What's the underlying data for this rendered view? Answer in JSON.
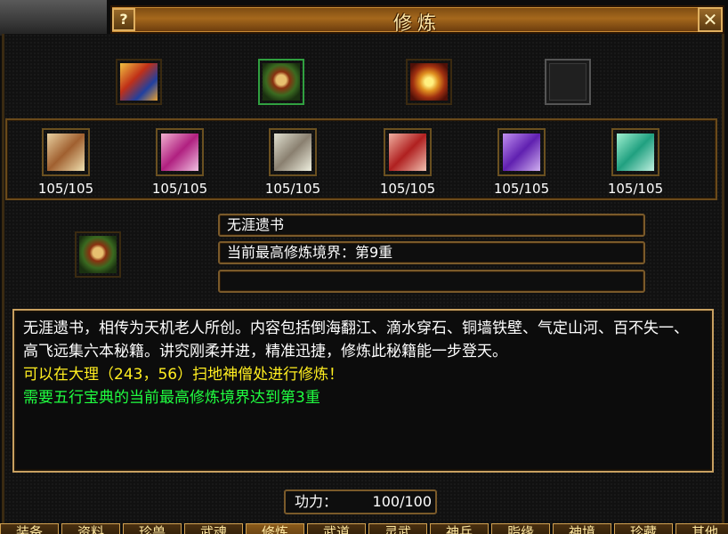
{
  "window": {
    "title": "修炼",
    "help_label": "?",
    "close_label": "✕"
  },
  "books": [
    {
      "icon": "red-blue-book-icon",
      "selected": false
    },
    {
      "icon": "scroll-bundle-book-icon",
      "selected": true
    },
    {
      "icon": "gold-treasure-book-icon",
      "selected": false
    },
    {
      "icon": "empty-slot-icon",
      "selected": false
    }
  ],
  "scrolls": [
    {
      "icon": "brown-scroll-icon",
      "count": "105/105"
    },
    {
      "icon": "pink-scroll-icon",
      "count": "105/105"
    },
    {
      "icon": "grey-scroll-icon",
      "count": "105/105"
    },
    {
      "icon": "red-scroll-icon",
      "count": "105/105"
    },
    {
      "icon": "purple-scroll-icon",
      "count": "105/105"
    },
    {
      "icon": "teal-scroll-icon",
      "count": "105/105"
    }
  ],
  "selected": {
    "name": "无涯遗书",
    "realm": "当前最高修炼境界：第9重",
    "extra": ""
  },
  "description": {
    "text": "无涯遗书，相传为天机老人所创。内容包括倒海翻江、滴水穿石、铜墙铁壁、气定山河、百不失一、高飞远集六本秘籍。讲究刚柔并进，精准迅捷，修炼此秘籍能一步登天。",
    "location": "可以在大理（243，56）扫地神僧处进行修炼！",
    "requirement": "需要五行宝典的当前最高修炼境界达到第3重"
  },
  "power": {
    "label": "功力：",
    "value": "100/100"
  },
  "tabs": [
    {
      "label": "装备"
    },
    {
      "label": "资料"
    },
    {
      "label": "珍兽"
    },
    {
      "label": "武魂"
    },
    {
      "label": "修炼"
    },
    {
      "label": "武道"
    },
    {
      "label": "灵武"
    },
    {
      "label": "神兵"
    },
    {
      "label": "脂缘"
    },
    {
      "label": "神境"
    },
    {
      "label": "珍藏"
    },
    {
      "label": "其他"
    }
  ],
  "colors": {
    "title_gold": "#ffe8a8",
    "text_white": "#ffffff",
    "text_yellow": "#ffee20",
    "text_green": "#20ff40",
    "frame_gold": "#c8a060"
  }
}
